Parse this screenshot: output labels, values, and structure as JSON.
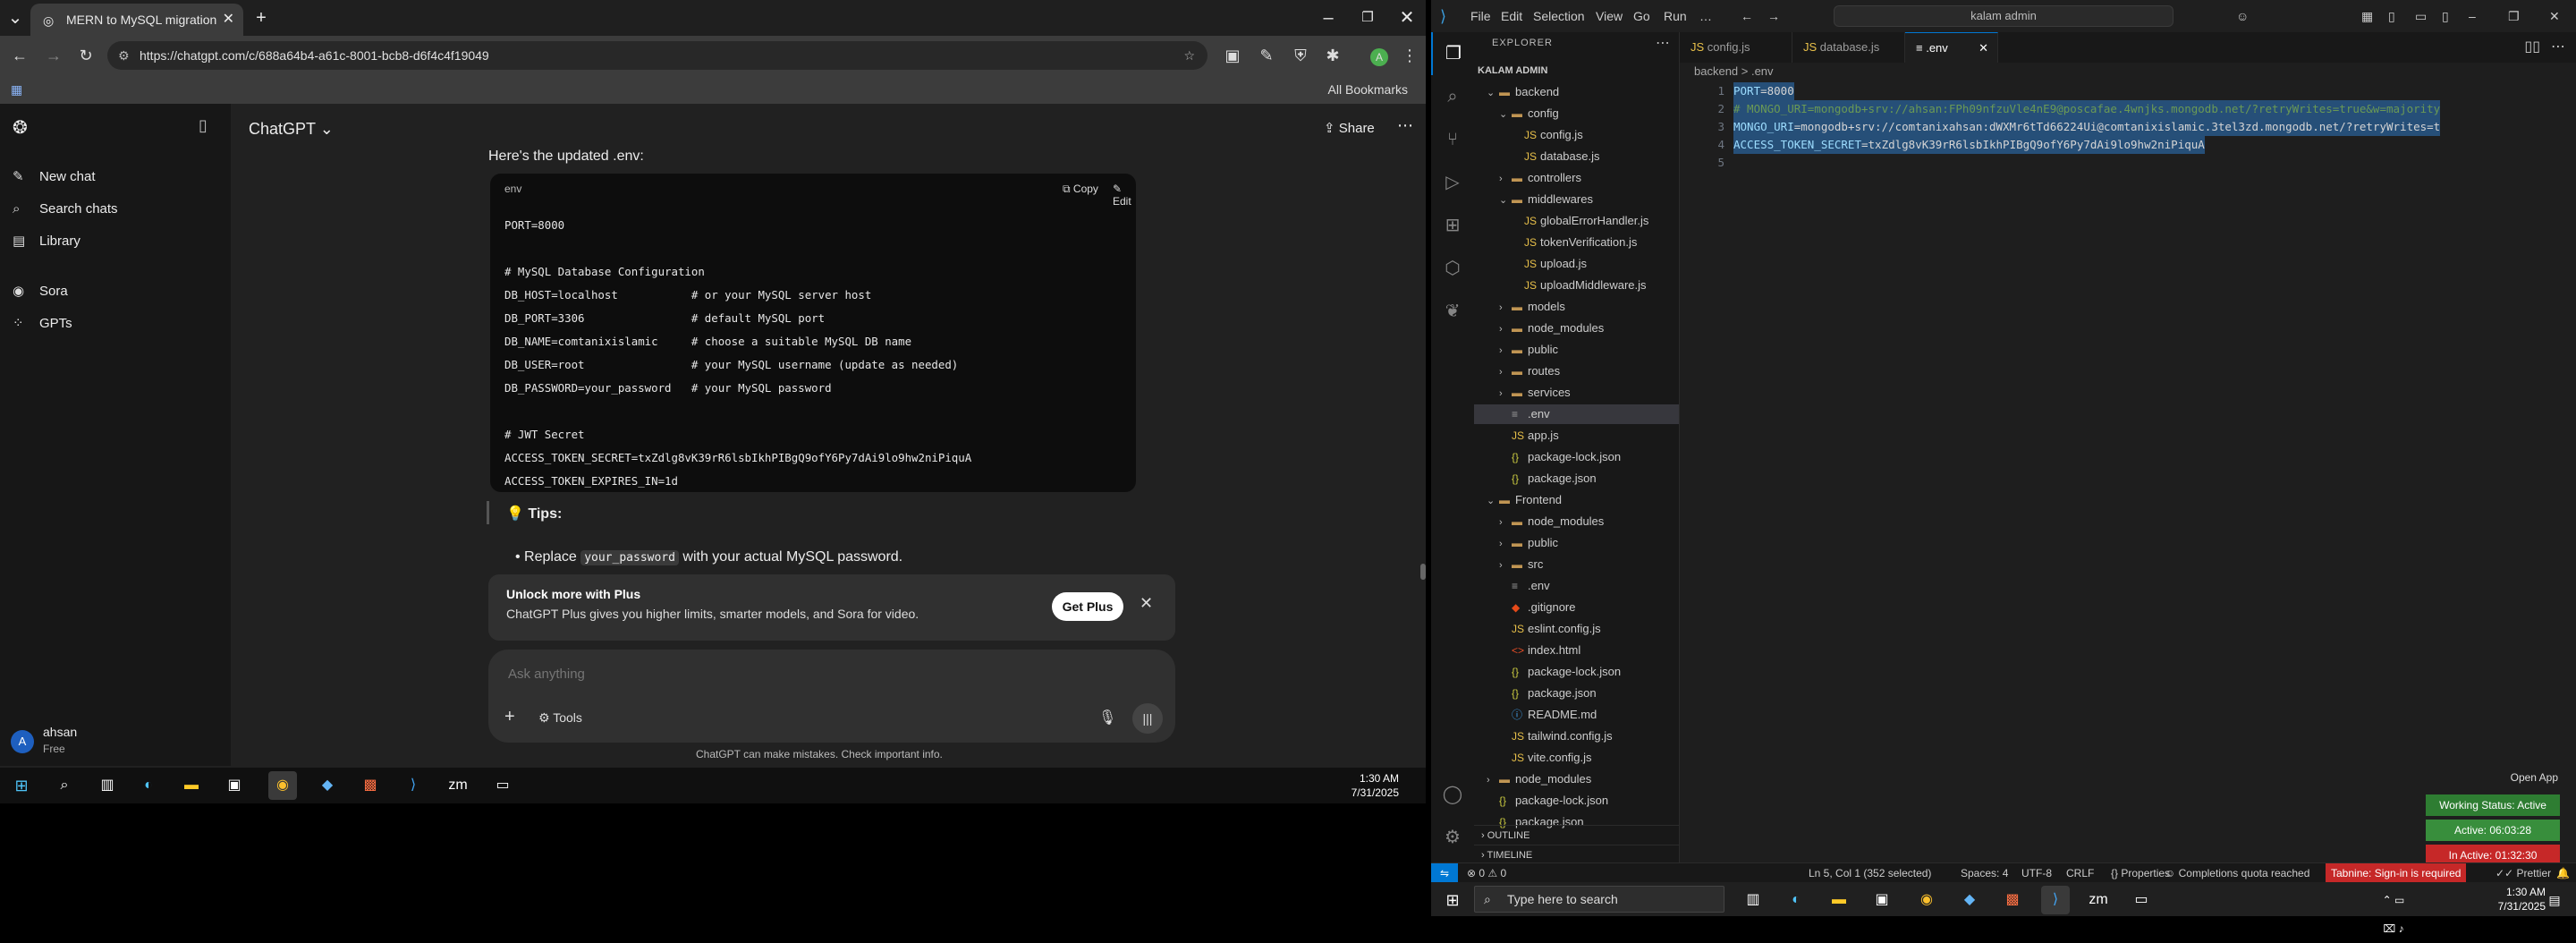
{
  "chrome": {
    "tab_title": "MERN to MySQL migration",
    "url": "https://chatgpt.com/c/688a64b4-a61c-8001-bcb8-d6f4c4f19049",
    "all_bookmarks": "All Bookmarks"
  },
  "chatgpt": {
    "sidebar": {
      "items": [
        {
          "label": "New chat",
          "icon": "edit-icon"
        },
        {
          "label": "Search chats",
          "icon": "search-icon"
        },
        {
          "label": "Library",
          "icon": "library-icon"
        },
        {
          "label": "Sora",
          "icon": "sora-icon"
        },
        {
          "label": "GPTs",
          "icon": "grid-icon"
        }
      ],
      "user": {
        "initial": "A",
        "name": "ahsan",
        "plan": "Free"
      }
    },
    "header": {
      "title": "ChatGPT",
      "share": "Share"
    },
    "message": {
      "intro": "Here's the updated .env:",
      "code_lang": "env",
      "copy": "Copy",
      "edit": "Edit",
      "code": [
        "PORT=8000",
        "",
        "# MySQL Database Configuration",
        "DB_HOST=localhost           # or your MySQL server host",
        "DB_PORT=3306                # default MySQL port",
        "DB_NAME=comtanixislamic     # choose a suitable MySQL DB name",
        "DB_USER=root                # your MySQL username (update as needed)",
        "DB_PASSWORD=your_password   # your MySQL password",
        "",
        "# JWT Secret",
        "ACCESS_TOKEN_SECRET=txZdlg8vK39rR6lsbIkhPIBgQ9ofY6Py7dAi9lo9hw2niPiquA",
        "ACCESS_TOKEN_EXPIRES_IN=1d"
      ],
      "tips_title": "💡 Tips:",
      "tip_prefix": "Replace ",
      "tip_code": "your_password",
      "tip_suffix": " with your actual MySQL password."
    },
    "upsell": {
      "title": "Unlock more with Plus",
      "subtitle": "ChatGPT Plus gives you higher limits, smarter models, and Sora for video.",
      "button": "Get Plus"
    },
    "composer": {
      "placeholder": "Ask anything",
      "tools": "Tools"
    },
    "disclaimer": "ChatGPT can make mistakes. Check important info."
  },
  "taskbar_left": {
    "time": "1:30 AM",
    "date": "7/31/2025"
  },
  "vscode": {
    "menu": [
      "File",
      "Edit",
      "Selection",
      "View",
      "Go",
      "Run",
      "…"
    ],
    "search": "kalam admin",
    "explorer_title": "EXPLORER",
    "root": "KALAM ADMIN",
    "tree": [
      {
        "label": "backend",
        "type": "folder-open",
        "depth": 1
      },
      {
        "label": "config",
        "type": "folder-open",
        "depth": 2
      },
      {
        "label": "config.js",
        "type": "js",
        "depth": 3
      },
      {
        "label": "database.js",
        "type": "js",
        "depth": 3
      },
      {
        "label": "controllers",
        "type": "folder",
        "depth": 2
      },
      {
        "label": "middlewares",
        "type": "folder-open",
        "depth": 2
      },
      {
        "label": "globalErrorHandler.js",
        "type": "js",
        "depth": 3
      },
      {
        "label": "tokenVerification.js",
        "type": "js",
        "depth": 3
      },
      {
        "label": "upload.js",
        "type": "js",
        "depth": 3
      },
      {
        "label": "uploadMiddleware.js",
        "type": "js",
        "depth": 3
      },
      {
        "label": "models",
        "type": "folder",
        "depth": 2
      },
      {
        "label": "node_modules",
        "type": "folder",
        "depth": 2
      },
      {
        "label": "public",
        "type": "folder",
        "depth": 2
      },
      {
        "label": "routes",
        "type": "folder",
        "depth": 2
      },
      {
        "label": "services",
        "type": "folder",
        "depth": 2
      },
      {
        "label": ".env",
        "type": "env",
        "depth": 2,
        "selected": true
      },
      {
        "label": "app.js",
        "type": "js",
        "depth": 2
      },
      {
        "label": "package-lock.json",
        "type": "json",
        "depth": 2
      },
      {
        "label": "package.json",
        "type": "json",
        "depth": 2
      },
      {
        "label": "Frontend",
        "type": "folder-open",
        "depth": 1
      },
      {
        "label": "node_modules",
        "type": "folder",
        "depth": 2
      },
      {
        "label": "public",
        "type": "folder",
        "depth": 2
      },
      {
        "label": "src",
        "type": "folder",
        "depth": 2
      },
      {
        "label": ".env",
        "type": "env",
        "depth": 2
      },
      {
        "label": ".gitignore",
        "type": "git",
        "depth": 2
      },
      {
        "label": "eslint.config.js",
        "type": "js",
        "depth": 2
      },
      {
        "label": "index.html",
        "type": "html",
        "depth": 2
      },
      {
        "label": "package-lock.json",
        "type": "json",
        "depth": 2
      },
      {
        "label": "package.json",
        "type": "json",
        "depth": 2
      },
      {
        "label": "README.md",
        "type": "md",
        "depth": 2
      },
      {
        "label": "tailwind.config.js",
        "type": "js",
        "depth": 2
      },
      {
        "label": "vite.config.js",
        "type": "js",
        "depth": 2
      },
      {
        "label": "node_modules",
        "type": "folder",
        "depth": 1
      },
      {
        "label": "package-lock.json",
        "type": "json",
        "depth": 1
      },
      {
        "label": "package.json",
        "type": "json",
        "depth": 1
      }
    ],
    "outline": "OUTLINE",
    "timeline": "TIMELINE",
    "tabs": [
      {
        "label": "config.js",
        "active": false
      },
      {
        "label": "database.js",
        "active": false
      },
      {
        "label": ".env",
        "active": true
      }
    ],
    "breadcrumbs": "backend  >  .env",
    "editor_lines": [
      {
        "n": "1",
        "key": "PORT",
        "rest": "=8000",
        "kind": "plain"
      },
      {
        "n": "2",
        "key": "",
        "rest": "# MONGO_URI=mongodb+srv://ahsan:FPh09nfzuVle4nE9@poscafae.4wnjks.mongodb.net/?retryWrites=true&w=majority",
        "kind": "comment"
      },
      {
        "n": "3",
        "key": "MONGO_URI",
        "rest": "=mongodb+srv://comtanixahsan:dWXMr6tTd66224Ui@comtanixislamic.3tel3zd.mongodb.net/?retryWrites=t",
        "kind": "plain"
      },
      {
        "n": "4",
        "key": "ACCESS_TOKEN_SECRET",
        "rest": "=txZdlg8vK39rR6lsbIkhPIBgQ9ofY6Py7dAi9lo9hw2niPiquA",
        "kind": "plain"
      },
      {
        "n": "5",
        "key": "",
        "rest": "",
        "kind": "plain"
      }
    ],
    "status": {
      "left": "⊗ 0  ⚠ 0",
      "position": "Ln 5, Col 1 (352 selected)",
      "spaces": "Spaces: 4",
      "encoding": "UTF-8",
      "eol": "CRLF",
      "properties": "Properties",
      "quota": "Completions quota reached",
      "tabnine": "Tabnine: Sign-in is required",
      "prettier": "Prettier"
    },
    "overlay": {
      "open_app": "Open App",
      "working": "Working Status: Active",
      "active": "Active: 06:03:28",
      "inactive": "In Active: 01:32:30"
    }
  },
  "taskbar_right": {
    "search": "Type here to search",
    "time": "1:30 AM",
    "date": "7/31/2025"
  },
  "colors": {
    "accent": "#0078d4",
    "working": "#2e7d32",
    "active": "#388e3c",
    "inactive": "#c62828"
  }
}
